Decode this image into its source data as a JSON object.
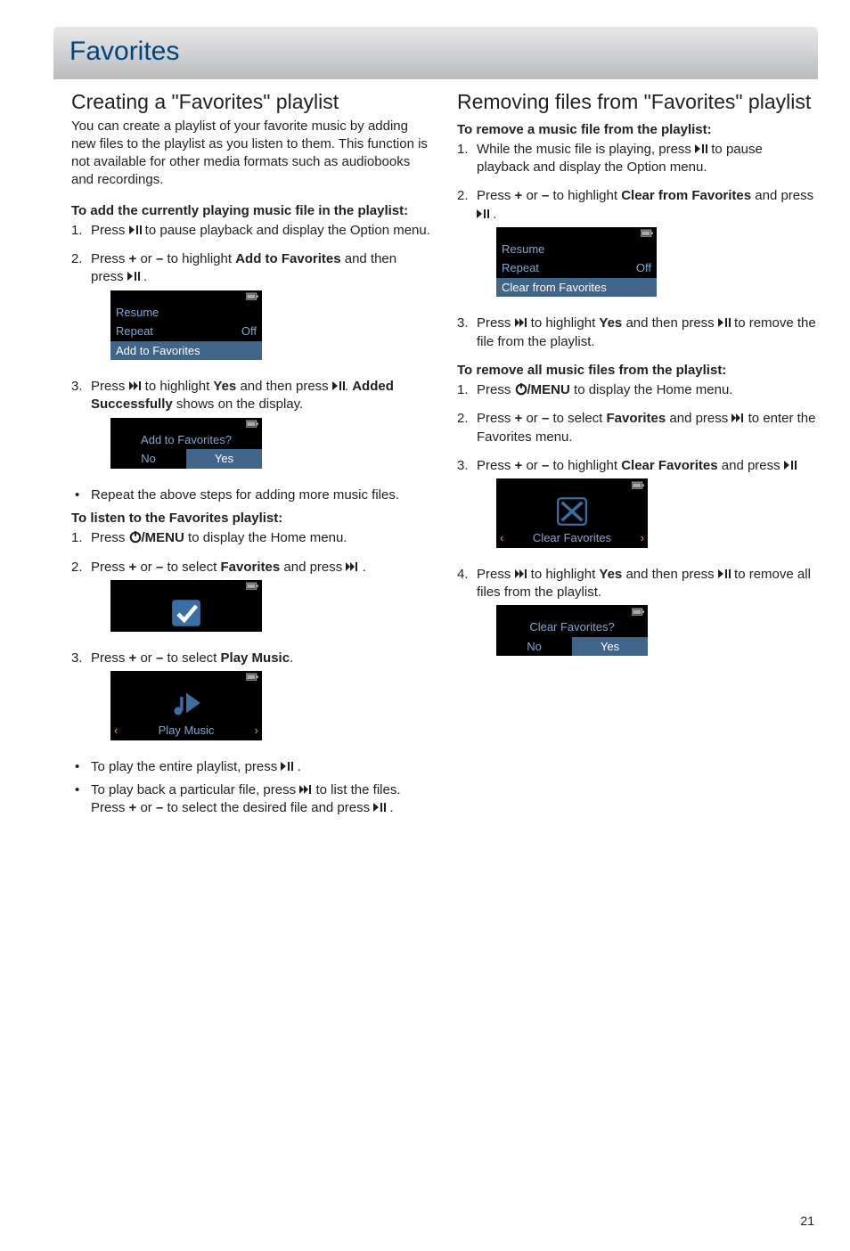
{
  "page_number": "21",
  "header": "Favorites",
  "left": {
    "h2": "Creating a \"Favorites\" playlist",
    "intro": "You can create a playlist of your favorite music by adding new files to the playlist as you listen to them. This function is not available for other media formats such as audiobooks and recordings.",
    "sub1": "To add the currently playing music file in the playlist:",
    "s1_1a": "Press ",
    "s1_1b": " to pause playback and display the Option menu.",
    "s1_2a": "Press ",
    "s1_2b": " or ",
    "s1_2c": " to highlight ",
    "s1_2d": "Add to Favorites",
    "s1_2e": " and then press ",
    "s1_2f": " .",
    "plus": "+",
    "minus": "–",
    "screen1": {
      "r1": "Resume",
      "r2l": "Repeat",
      "r2r": "Off",
      "r3": "Add to Favorites"
    },
    "s1_3a": "Press ",
    "s1_3b": " to highlight ",
    "s1_3c": "Yes",
    "s1_3d": " and then press ",
    "s1_3e": ". ",
    "s1_3f": "Added Successfully",
    "s1_3g": " shows on the display.",
    "screen2": {
      "q": "Add to Favorites?",
      "no": "No",
      "yes": "Yes"
    },
    "bullet1": "Repeat the above steps for adding more music files.",
    "sub2": "To listen to the Favorites playlist:",
    "s2_1a": "Press ",
    "s2_1b": "/MENU",
    "s2_1c": " to display the Home menu.",
    "s2_2a": "Press ",
    "s2_2b": " or ",
    "s2_2c": " to select ",
    "s2_2d": "Favorites",
    "s2_2e": " and press ",
    "s2_2f": " .",
    "s2_3a": "Press ",
    "s2_3b": " or ",
    "s2_3c": " to select ",
    "s2_3d": "Play Music",
    "s2_3e": ".",
    "screen_nav": {
      "label": "Play Music"
    },
    "bp1a": "To play the entire playlist, press ",
    "bp1b": " .",
    "bp2a": "To play back a particular file, press ",
    "bp2b": " to list the files. Press ",
    "bp2c": " or ",
    "bp2d": " to select the desired file and press ",
    "bp2e": " ."
  },
  "right": {
    "h2": "Removing files from \"Favorites\" playlist",
    "sub1": "To remove a music file from the playlist:",
    "r1_1a": "While the music file is playing, press ",
    "r1_1b": " to pause playback and display the Option menu.",
    "r1_2a": "Press ",
    "r1_2b": " or ",
    "r1_2c": " to highlight ",
    "r1_2d": "Clear from Favorites",
    "r1_2e": " and press ",
    "r1_2f": " .",
    "screen1": {
      "r1": "Resume",
      "r2l": "Repeat",
      "r2r": "Off",
      "r3": "Clear from Favorites"
    },
    "r1_3a": "Press ",
    "r1_3b": " to highlight ",
    "r1_3c": "Yes",
    "r1_3d": " and then press ",
    "r1_3e": " to remove the file from the playlist.",
    "sub2": "To remove all music files from the playlist:",
    "r2_1a": "Press ",
    "r2_1b": "/MENU",
    "r2_1c": " to display the Home menu.",
    "r2_2a": "Press ",
    "r2_2b": " or ",
    "r2_2c": " to select ",
    "r2_2d": "Favorites",
    "r2_2e": " and press ",
    "r2_2f": " to enter the Favorites menu.",
    "r2_3a": "Press ",
    "r2_3b": " or ",
    "r2_3c": " to highlight ",
    "r2_3d": "Clear Favorites",
    "r2_3e": " and press ",
    "screen_nav": {
      "label": "Clear Favorites"
    },
    "r2_4a": "Press ",
    "r2_4b": " to highlight ",
    "r2_4c": "Yes",
    "r2_4d": " and then press ",
    "r2_4e": " to remove all files from the playlist.",
    "screen2": {
      "q": "Clear Favorites?",
      "no": "No",
      "yes": "Yes"
    }
  }
}
